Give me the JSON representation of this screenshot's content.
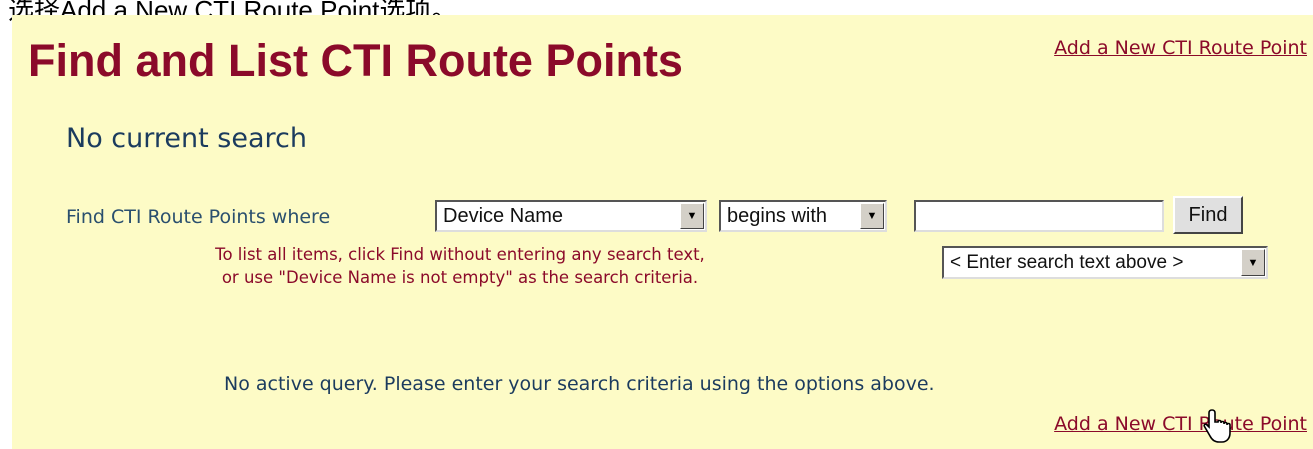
{
  "caption": "选择Add a New CTI Route Point选项。",
  "page": {
    "title": "Find and List CTI Route Points",
    "add_link_top": "Add a New CTI Route Point",
    "add_link_bottom": "Add a New CTI Route Point",
    "search_status": "No current search"
  },
  "search": {
    "label": "Find CTI Route Points where",
    "field_select_value": "Device Name",
    "operator_select_value": "begins with",
    "input_value": "",
    "find_button_label": "Find",
    "hint_select_value": "< Enter search text above >",
    "help_line1": "To list all items, click Find without entering any search text,",
    "help_line2": "or use \"Device Name is not empty\" as the search criteria."
  },
  "results": {
    "status_message": "No active query. Please enter your search criteria using the options above."
  },
  "colors": {
    "panel_bg": "#fdfbc6",
    "title": "#8b0a2a",
    "label": "#1b3b5e"
  },
  "icons": {
    "dropdown": "triangle-down-icon",
    "cursor": "hand-pointer-icon"
  }
}
